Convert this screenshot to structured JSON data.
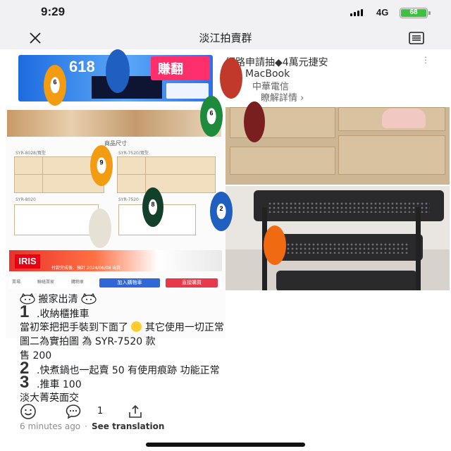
{
  "status_bar": {
    "time": "9:29",
    "network": "4G",
    "battery": "68",
    "battery_color": "#3ec13e"
  },
  "nav": {
    "title": "淡江拍賣群",
    "close_icon": "close-icon",
    "menu_icon": "menu-icon"
  },
  "ad": {
    "banner_text": "618",
    "banner_cn": "賺翻",
    "title_line1": "網路申請抽◆4萬元捷安",
    "title_line2": "特、MacBook",
    "provider": "中華電信",
    "more_link": "瞭解詳情 ›"
  },
  "listing_image": {
    "caption": "商品尺寸",
    "models": [
      "SYR-8028/寬型",
      "SYR-7520/寬型",
      "SYR-8020",
      "SYR-7520"
    ],
    "brand": "IRIS",
    "brand_note": "付款完成後．預計 2024/06/08 出貨",
    "buttons": {
      "cart": "加入購物車",
      "buy": "直接購買"
    },
    "mini_labels": [
      "賣場",
      "聯絡賣家",
      "購物車"
    ]
  },
  "post": {
    "header": "搬家出清",
    "items": [
      {
        "number": "1",
        "text": ".收納櫃推車"
      },
      {
        "number": "",
        "text": "當初笨把把手裝到下面了"
      },
      {
        "number": "",
        "text": "其它使用一切正常"
      },
      {
        "number": "",
        "text": "圖二為實拍圖 為 SYR-7520 款"
      },
      {
        "number": "",
        "text": "售 200"
      },
      {
        "number": "2",
        "text": ".快煮鍋也一起賣 50 有使用痕跡 功能正常"
      },
      {
        "number": "3",
        "text": ".推車 100"
      },
      {
        "number": "",
        "text": "淡大菁英面交"
      }
    ]
  },
  "actions": {
    "comment_count": "1",
    "time_ago": "6 minutes ago",
    "separator": "·",
    "translate": "See translation"
  },
  "colors": {
    "accent_blue": "#2f67d6",
    "accent_red": "#e8394b"
  }
}
